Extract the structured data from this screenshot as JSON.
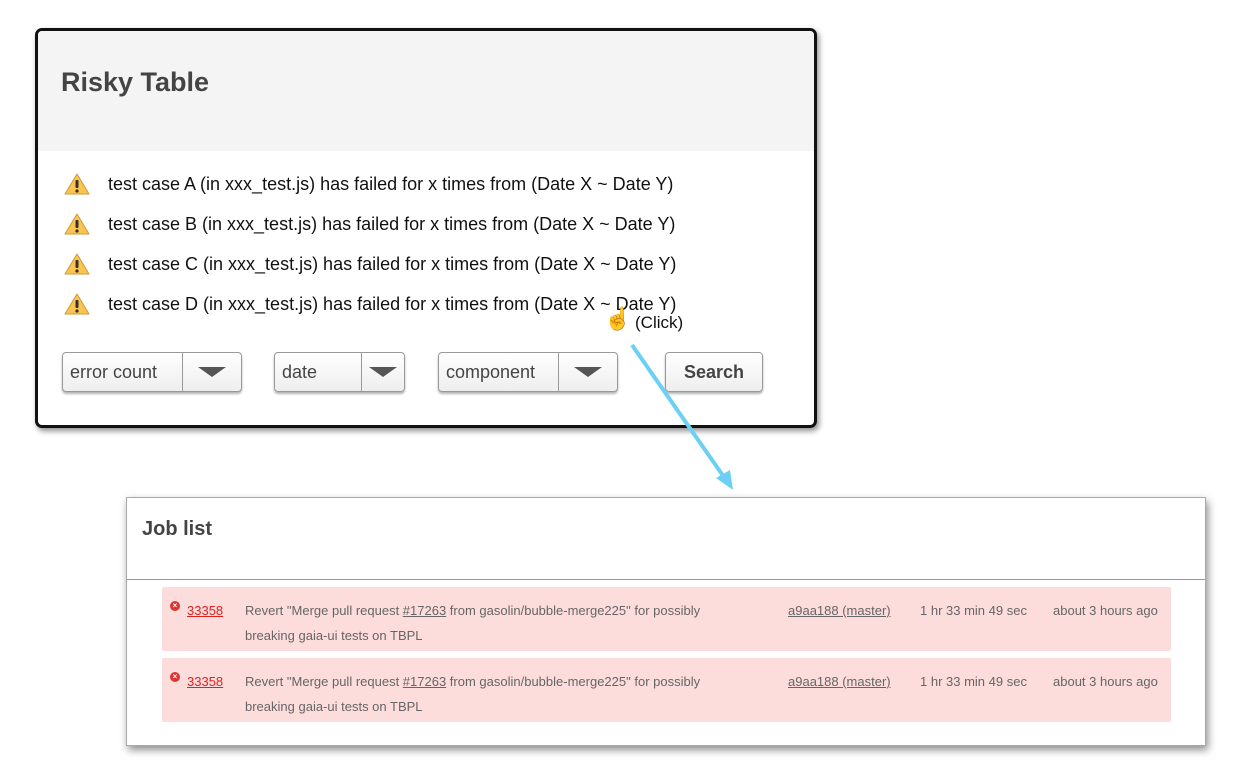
{
  "risky_table": {
    "title": "Risky Table",
    "items": [
      {
        "icon": "warning-icon",
        "text": "test case A (in xxx_test.js) has failed for x times from (Date X ~ Date Y)"
      },
      {
        "icon": "warning-icon",
        "text": "test case B (in xxx_test.js) has failed for x times from (Date X ~ Date Y)"
      },
      {
        "icon": "warning-icon",
        "text": "test case C (in xxx_test.js) has failed for x times from (Date X ~ Date Y)"
      },
      {
        "icon": "warning-icon",
        "text": "test case D (in xxx_test.js) has failed for x times from (Date X ~ Date Y)"
      }
    ],
    "filters": {
      "error_count": "error count",
      "date": "date",
      "component": "component"
    },
    "search_label": "Search"
  },
  "annotation": {
    "click_label": "(Click)",
    "arrow_color": "#6cd0f5"
  },
  "job_list": {
    "title": "Job list",
    "row_color": "#fddcdc",
    "rows": [
      {
        "id": "33358",
        "msg_pre": "Revert \"Merge pull request ",
        "pr": "#17263",
        "msg_post": " from gasolin/bubble-merge225\" for possibly",
        "msg_line2": "breaking gaia-ui tests on TBPL",
        "commit": "a9aa188 (master)",
        "duration": "1 hr 33 min 49 sec",
        "time": "about 3 hours ago"
      },
      {
        "id": "33358",
        "msg_pre": "Revert \"Merge pull request ",
        "pr": "#17263",
        "msg_post": " from gasolin/bubble-merge225\" for possibly",
        "msg_line2": "breaking gaia-ui tests on TBPL",
        "commit": "a9aa188 (master)",
        "duration": "1 hr 33 min 49 sec",
        "time": "about 3 hours ago"
      }
    ]
  }
}
